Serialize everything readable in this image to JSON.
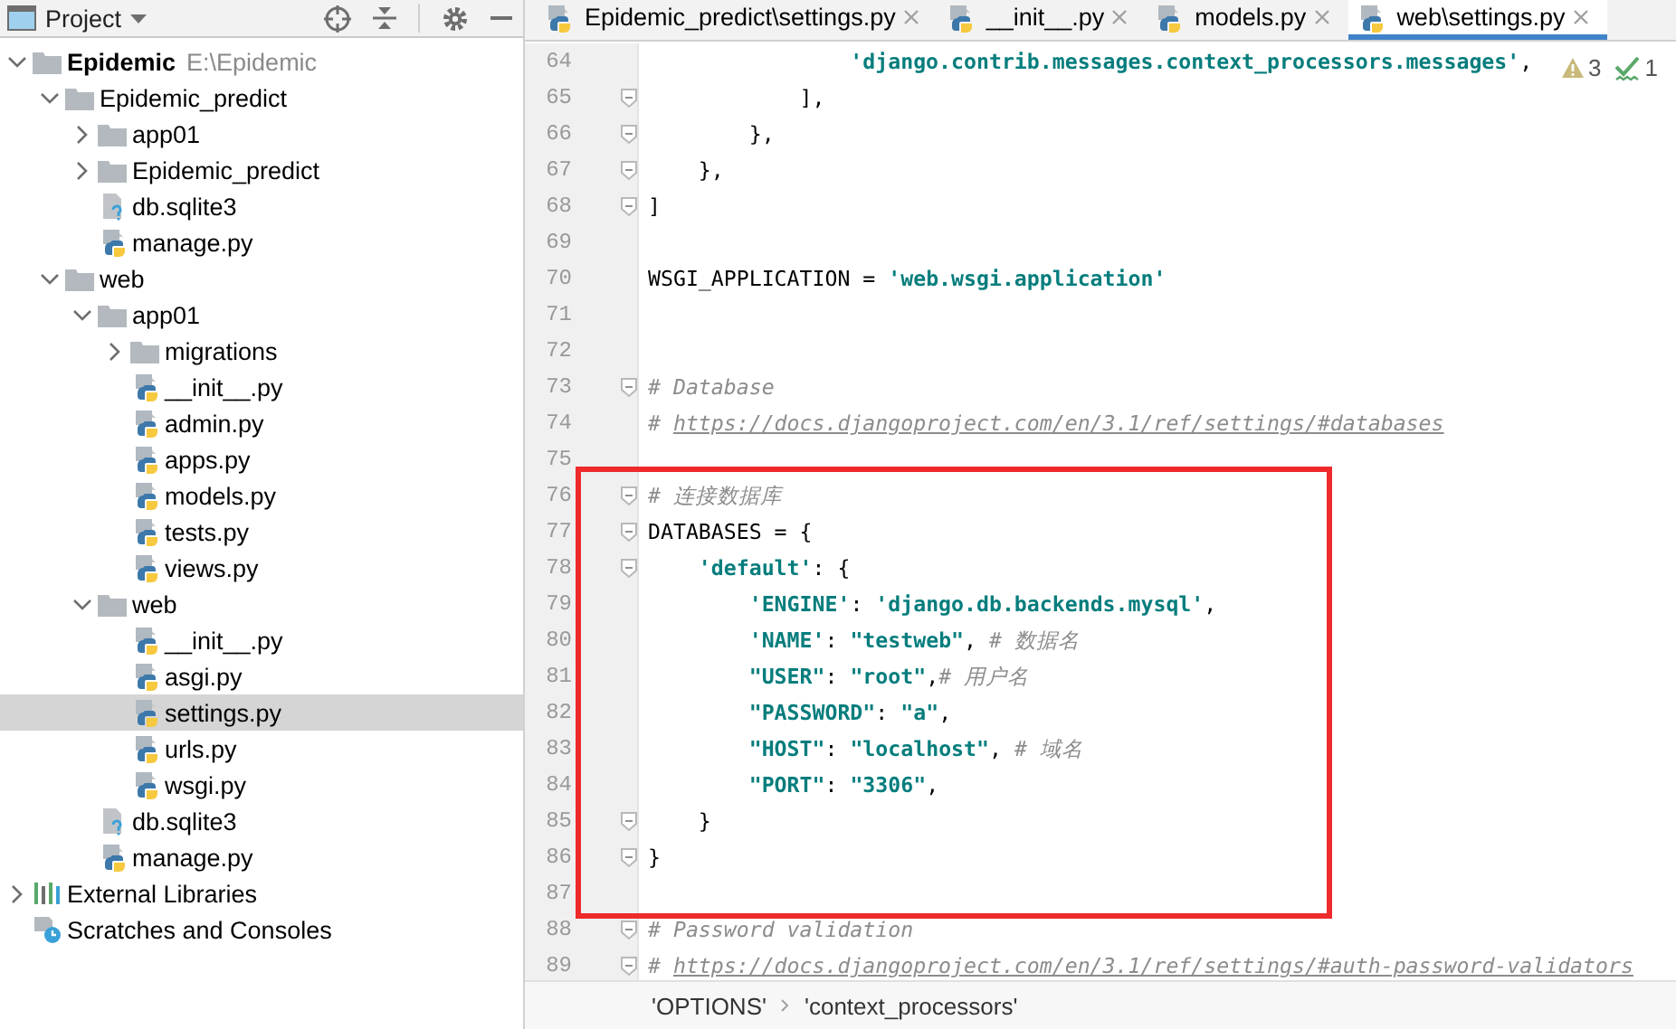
{
  "project_panel": {
    "title": "Project",
    "tree": [
      {
        "label": "Epidemic",
        "path": "E:\\Epidemic",
        "kind": "folder",
        "expanded": true,
        "selected": false,
        "children": [
          {
            "label": "Epidemic_predict",
            "kind": "folder",
            "expanded": true,
            "selected": false,
            "children": [
              {
                "label": "app01",
                "kind": "folder",
                "expanded": false,
                "selected": false
              },
              {
                "label": "Epidemic_predict",
                "kind": "folder",
                "expanded": false,
                "selected": false
              },
              {
                "label": "db.sqlite3",
                "kind": "file",
                "selected": false
              },
              {
                "label": "manage.py",
                "kind": "python",
                "selected": false
              }
            ]
          },
          {
            "label": "web",
            "kind": "folder",
            "expanded": true,
            "selected": false,
            "children": [
              {
                "label": "app01",
                "kind": "folder",
                "expanded": true,
                "selected": false,
                "children": [
                  {
                    "label": "migrations",
                    "kind": "folder",
                    "expanded": false,
                    "selected": false
                  },
                  {
                    "label": "__init__.py",
                    "kind": "python",
                    "selected": false
                  },
                  {
                    "label": "admin.py",
                    "kind": "python",
                    "selected": false
                  },
                  {
                    "label": "apps.py",
                    "kind": "python",
                    "selected": false
                  },
                  {
                    "label": "models.py",
                    "kind": "python",
                    "selected": false
                  },
                  {
                    "label": "tests.py",
                    "kind": "python",
                    "selected": false
                  },
                  {
                    "label": "views.py",
                    "kind": "python",
                    "selected": false
                  }
                ]
              },
              {
                "label": "web",
                "kind": "folder",
                "expanded": true,
                "selected": false,
                "children": [
                  {
                    "label": "__init__.py",
                    "kind": "python",
                    "selected": false
                  },
                  {
                    "label": "asgi.py",
                    "kind": "python",
                    "selected": false
                  },
                  {
                    "label": "settings.py",
                    "kind": "python",
                    "selected": true
                  },
                  {
                    "label": "urls.py",
                    "kind": "python",
                    "selected": false
                  },
                  {
                    "label": "wsgi.py",
                    "kind": "python",
                    "selected": false
                  }
                ]
              },
              {
                "label": "db.sqlite3",
                "kind": "file",
                "selected": false
              },
              {
                "label": "manage.py",
                "kind": "python",
                "selected": false
              }
            ]
          }
        ]
      },
      {
        "label": "External Libraries",
        "kind": "libraries",
        "expanded": false,
        "selected": false
      },
      {
        "label": "Scratches and Consoles",
        "kind": "scratches",
        "selected": false
      }
    ]
  },
  "editor": {
    "tabs": [
      {
        "label": "Epidemic_predict\\settings.py",
        "selected": false
      },
      {
        "label": "__init__.py",
        "selected": false
      },
      {
        "label": "models.py",
        "selected": false
      },
      {
        "label": "web\\settings.py",
        "selected": true
      }
    ],
    "inspections": {
      "warnings": "3",
      "passed": "1"
    },
    "lines": [
      {
        "number": "64",
        "fold": false,
        "highlighted": false,
        "tokens": [
          {
            "kind": "str",
            "text": "                'django.contrib.messages.context_processors.messages'"
          },
          {
            "kind": "plain",
            "text": ","
          }
        ]
      },
      {
        "number": "65",
        "fold": true,
        "highlighted": false,
        "tokens": [
          {
            "kind": "plain",
            "text": "            ],"
          }
        ]
      },
      {
        "number": "66",
        "fold": true,
        "highlighted": false,
        "tokens": [
          {
            "kind": "plain",
            "text": "        },"
          }
        ]
      },
      {
        "number": "67",
        "fold": true,
        "highlighted": false,
        "tokens": [
          {
            "kind": "plain",
            "text": "    },"
          }
        ]
      },
      {
        "number": "68",
        "fold": true,
        "highlighted": false,
        "tokens": [
          {
            "kind": "plain",
            "text": "]"
          }
        ]
      },
      {
        "number": "69",
        "fold": false,
        "highlighted": false
      },
      {
        "number": "70",
        "fold": false,
        "highlighted": false,
        "tokens": [
          {
            "kind": "plain",
            "text": "WSGI_APPLICATION = "
          },
          {
            "kind": "str",
            "text": "'web.wsgi.application'"
          }
        ]
      },
      {
        "number": "71",
        "fold": false,
        "highlighted": false
      },
      {
        "number": "72",
        "fold": false,
        "highlighted": false
      },
      {
        "number": "73",
        "fold": true,
        "highlighted": false,
        "tokens": [
          {
            "kind": "comment",
            "text": "# Database"
          }
        ]
      },
      {
        "number": "74",
        "fold": false,
        "highlighted": false,
        "tokens": [
          {
            "kind": "comment",
            "text": "# "
          },
          {
            "kind": "link",
            "text": "https://docs.djangoproject.com/en/3.1/ref/settings/#databases"
          }
        ]
      },
      {
        "number": "75",
        "fold": false,
        "highlighted": false
      },
      {
        "number": "76",
        "fold": true,
        "highlighted": true,
        "tokens": [
          {
            "kind": "comment",
            "text": "# 连接数据库"
          }
        ]
      },
      {
        "number": "77",
        "fold": true,
        "highlighted": true,
        "tokens": [
          {
            "kind": "plain",
            "text": "DATABASES = {"
          }
        ]
      },
      {
        "number": "78",
        "fold": true,
        "highlighted": true,
        "tokens": [
          {
            "kind": "str",
            "text": "    'default'"
          },
          {
            "kind": "plain",
            "text": ": {"
          }
        ]
      },
      {
        "number": "79",
        "fold": false,
        "highlighted": true,
        "tokens": [
          {
            "kind": "str",
            "text": "        'ENGINE'"
          },
          {
            "kind": "plain",
            "text": ": "
          },
          {
            "kind": "str",
            "text": "'django.db.backends.mysql'"
          },
          {
            "kind": "plain",
            "text": ","
          }
        ]
      },
      {
        "number": "80",
        "fold": false,
        "highlighted": true,
        "tokens": [
          {
            "kind": "str",
            "text": "        'NAME'"
          },
          {
            "kind": "plain",
            "text": ": "
          },
          {
            "kind": "str",
            "text": "\"testweb\""
          },
          {
            "kind": "plain",
            "text": ", "
          },
          {
            "kind": "comment",
            "text": "# 数据名"
          }
        ]
      },
      {
        "number": "81",
        "fold": false,
        "highlighted": true,
        "tokens": [
          {
            "kind": "str",
            "text": "        \"USER\""
          },
          {
            "kind": "plain",
            "text": ": "
          },
          {
            "kind": "str",
            "text": "\"root\""
          },
          {
            "kind": "plain",
            "text": ","
          },
          {
            "kind": "comment",
            "text": "# 用户名"
          }
        ]
      },
      {
        "number": "82",
        "fold": false,
        "highlighted": true,
        "tokens": [
          {
            "kind": "str",
            "text": "        \"PASSWORD\""
          },
          {
            "kind": "plain",
            "text": ": "
          },
          {
            "kind": "str",
            "text": "\"a\""
          },
          {
            "kind": "plain",
            "text": ","
          }
        ]
      },
      {
        "number": "83",
        "fold": false,
        "highlighted": true,
        "tokens": [
          {
            "kind": "str",
            "text": "        \"HOST\""
          },
          {
            "kind": "plain",
            "text": ": "
          },
          {
            "kind": "str",
            "text": "\"localhost\""
          },
          {
            "kind": "plain",
            "text": ", "
          },
          {
            "kind": "comment",
            "text": "# 域名"
          }
        ]
      },
      {
        "number": "84",
        "fold": false,
        "highlighted": true,
        "tokens": [
          {
            "kind": "str",
            "text": "        \"PORT\""
          },
          {
            "kind": "plain",
            "text": ": "
          },
          {
            "kind": "str",
            "text": "\"3306\""
          },
          {
            "kind": "plain",
            "text": ","
          }
        ]
      },
      {
        "number": "85",
        "fold": true,
        "highlighted": true,
        "tokens": [
          {
            "kind": "plain",
            "text": "    }"
          }
        ]
      },
      {
        "number": "86",
        "fold": true,
        "highlighted": true,
        "tokens": [
          {
            "kind": "plain",
            "text": "}"
          }
        ]
      },
      {
        "number": "87",
        "fold": false,
        "highlighted": true
      },
      {
        "number": "88",
        "fold": true,
        "highlighted": false,
        "tokens": [
          {
            "kind": "comment",
            "text": "# Password validation"
          }
        ]
      },
      {
        "number": "89",
        "fold": true,
        "highlighted": false,
        "tokens": [
          {
            "kind": "comment",
            "text": "# "
          },
          {
            "kind": "link",
            "text": "https://docs.djangoproject.com/en/3.1/ref/settings/#auth-password-validators"
          }
        ]
      }
    ],
    "breadcrumbs": [
      "'OPTIONS'",
      "'context_processors'"
    ]
  }
}
